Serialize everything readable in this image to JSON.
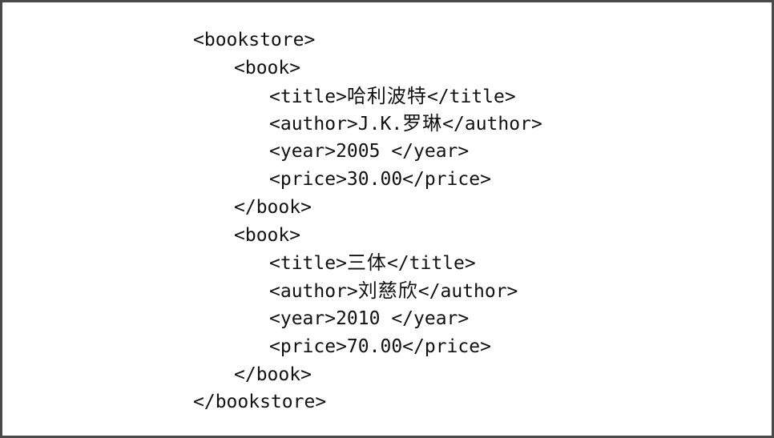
{
  "document": {
    "lines": [
      {
        "indent": 0,
        "name": "bookstore-open-tag",
        "parts": [
          {
            "text": "<bookstore>"
          }
        ]
      },
      {
        "indent": 1,
        "name": "book-open-tag",
        "parts": [
          {
            "text": "<book>"
          }
        ]
      },
      {
        "indent": 2,
        "name": "title-element",
        "parts": [
          {
            "text": "<title>"
          },
          {
            "text": "哈利波特",
            "cjk": true
          },
          {
            "text": "</title>"
          }
        ]
      },
      {
        "indent": 2,
        "name": "author-element",
        "parts": [
          {
            "text": "<author>"
          },
          {
            "text": "J.K."
          },
          {
            "text": "罗琳",
            "cjk": true
          },
          {
            "text": "</author>"
          }
        ]
      },
      {
        "indent": 2,
        "name": "year-element",
        "parts": [
          {
            "text": "<year>2005 </year>"
          }
        ]
      },
      {
        "indent": 2,
        "name": "price-element",
        "parts": [
          {
            "text": "<price>30.00</price>"
          }
        ]
      },
      {
        "indent": 1,
        "name": "book-close-tag",
        "parts": [
          {
            "text": "</book>"
          }
        ]
      },
      {
        "indent": 1,
        "name": "book-open-tag",
        "parts": [
          {
            "text": "<book>"
          }
        ]
      },
      {
        "indent": 2,
        "name": "title-element",
        "parts": [
          {
            "text": "<title>"
          },
          {
            "text": "三体",
            "cjk": true
          },
          {
            "text": "</title>"
          }
        ]
      },
      {
        "indent": 2,
        "name": "author-element",
        "parts": [
          {
            "text": "<author>"
          },
          {
            "text": "刘慈欣",
            "cjk": true
          },
          {
            "text": "</author>"
          }
        ]
      },
      {
        "indent": 2,
        "name": "year-element",
        "parts": [
          {
            "text": "<year>2010 </year>"
          }
        ]
      },
      {
        "indent": 2,
        "name": "price-element",
        "parts": [
          {
            "text": "<price>70.00</price>"
          }
        ]
      },
      {
        "indent": 1,
        "name": "book-close-tag",
        "parts": [
          {
            "text": "</book>"
          }
        ]
      },
      {
        "indent": 0,
        "name": "bookstore-close-tag",
        "parts": [
          {
            "text": "</bookstore>"
          }
        ]
      }
    ]
  }
}
